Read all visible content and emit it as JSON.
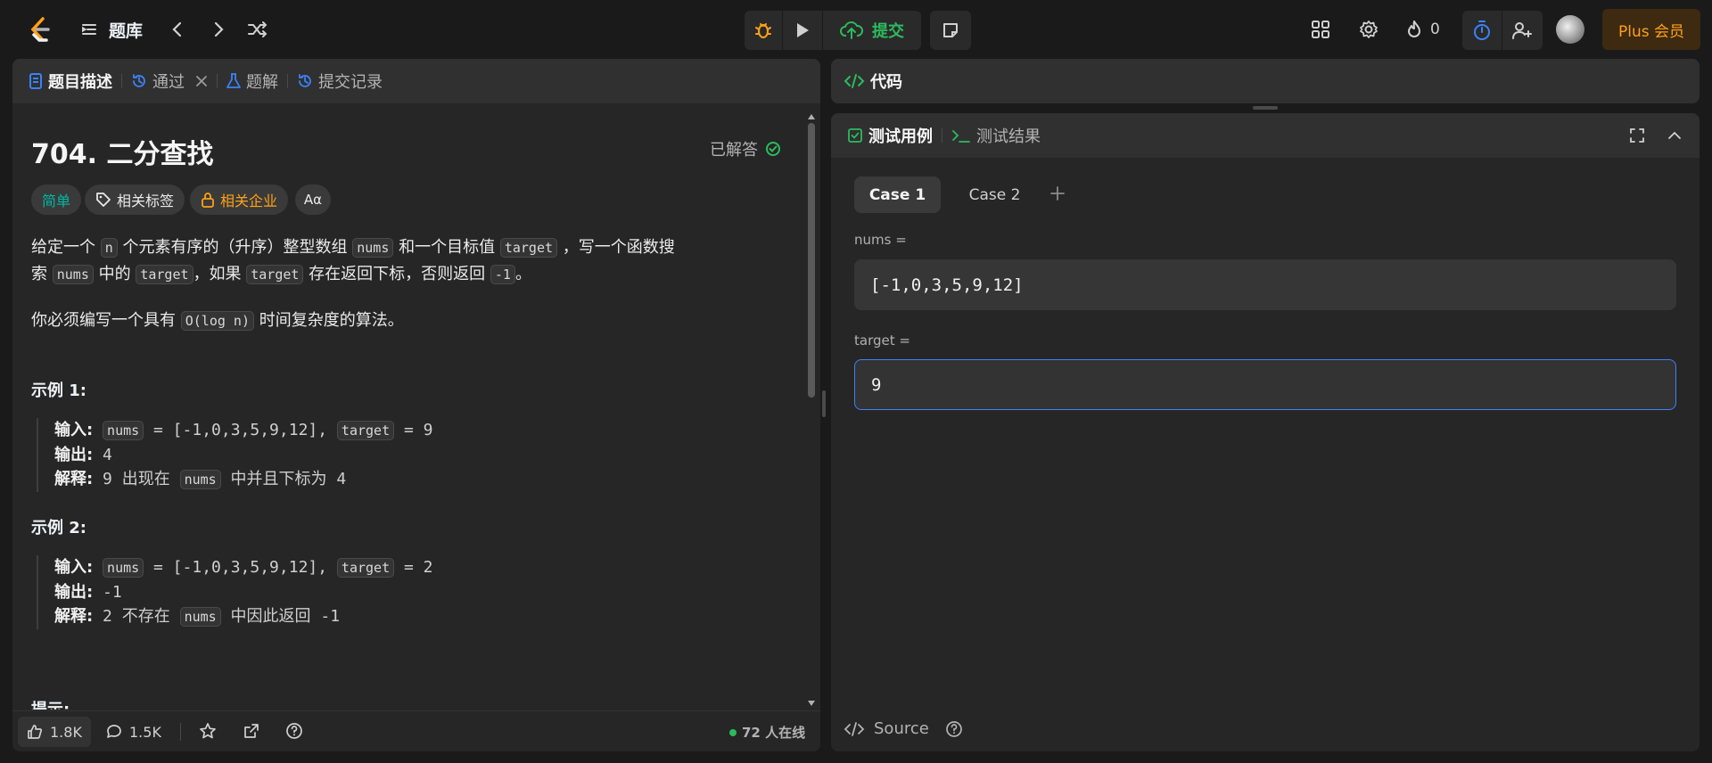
{
  "topbar": {
    "problem_list_label": "题库",
    "submit_label": "提交",
    "streak_count": "0",
    "plus_label": "Plus 会员"
  },
  "left_panel": {
    "tabs": [
      {
        "label": "题目描述"
      },
      {
        "label": "通过"
      },
      {
        "label": "题解"
      },
      {
        "label": "提交记录"
      }
    ],
    "title": "704. 二分查找",
    "solved_label": "已解答",
    "tags": {
      "difficulty": "简单",
      "related_tags": "相关标签",
      "companies": "相关企业",
      "translate": "Aα"
    },
    "description": {
      "line1_a": "给定一个",
      "n": "n",
      "line1_b": "个元素有序的（升序）整型数组",
      "nums": "nums",
      "line1_c": "和一个目标值",
      "target": "target",
      "line1_d": "，写一个函数搜",
      "line2_a": "索",
      "line2_b": "中的",
      "line2_c": "，如果",
      "line2_d": "存在返回下标，否则返回",
      "minus_one": "-1",
      "line2_e": "。",
      "complexity_a": "你必须编写一个具有",
      "complexity_code": "O(log n)",
      "complexity_b": "时间复杂度的算法。"
    },
    "examples": [
      {
        "title": "示例 1:",
        "input_label": "输入:",
        "input_eq1": " = [-1,0,3,5,9,12], ",
        "input_eq2": " = 9",
        "output_label": "输出:",
        "output": " 4",
        "explain_label": "解释:",
        "explain_a": " 9 出现在 ",
        "explain_b": " 中并且下标为 4"
      },
      {
        "title": "示例 2:",
        "input_label": "输入:",
        "input_eq1": " = [-1,0,3,5,9,12], ",
        "input_eq2": " = 2",
        "output_label": "输出:",
        "output": " -1",
        "explain_label": "解释:",
        "explain_a": " 2 不存在 ",
        "explain_b": " 中因此返回 -1"
      }
    ],
    "hints_cutoff": "提示:",
    "footer": {
      "likes": "1.8K",
      "comments": "1.5K",
      "online": "72 人在线"
    }
  },
  "code_panel": {
    "title": "代码"
  },
  "test_panel": {
    "tab_cases": "测试用例",
    "tab_results": "测试结果",
    "case_tabs": [
      "Case 1",
      "Case 2"
    ],
    "fields": [
      {
        "label": "nums =",
        "value": "[-1,0,3,5,9,12]"
      },
      {
        "label": "target =",
        "value": "9"
      }
    ],
    "source_label": "Source"
  },
  "colors": {
    "accent_green": "#2cbb5d",
    "accent_orange": "#ffa116",
    "accent_blue": "#3b82f6",
    "easy_teal": "#00b8a3"
  }
}
